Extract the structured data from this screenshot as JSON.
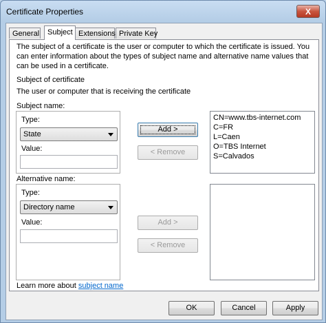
{
  "window": {
    "title": "Certificate Properties",
    "close": "X"
  },
  "tabs": [
    "General",
    "Subject",
    "Extensions",
    "Private Key"
  ],
  "intro": {
    "line1": "The subject of a certificate is the user or computer to which the certificate is issued. You",
    "line2": "can enter information about the types of subject name and alternative name values that",
    "line3": "can be used in a certificate."
  },
  "subject_of_cert": {
    "heading": "Subject of certificate",
    "description": "The user or computer that is receiving the certificate"
  },
  "subject_name": {
    "label": "Subject name:",
    "type_label": "Type:",
    "type_value": "State",
    "value_label": "Value:",
    "value": "",
    "add": "Add >",
    "remove": "< Remove",
    "entries": [
      "CN=www.tbs-internet.com",
      "C=FR",
      "L=Caen",
      "O=TBS Internet",
      "S=Calvados"
    ]
  },
  "alt_name": {
    "label": "Alternative name:",
    "type_label": "Type:",
    "type_value": "Directory name",
    "value_label": "Value:",
    "value": "",
    "add": "Add >",
    "remove": "< Remove",
    "entries": []
  },
  "learn_more": {
    "prefix": "Learn more about ",
    "link": "subject name"
  },
  "buttons": {
    "ok": "OK",
    "cancel": "Cancel",
    "apply": "Apply"
  }
}
